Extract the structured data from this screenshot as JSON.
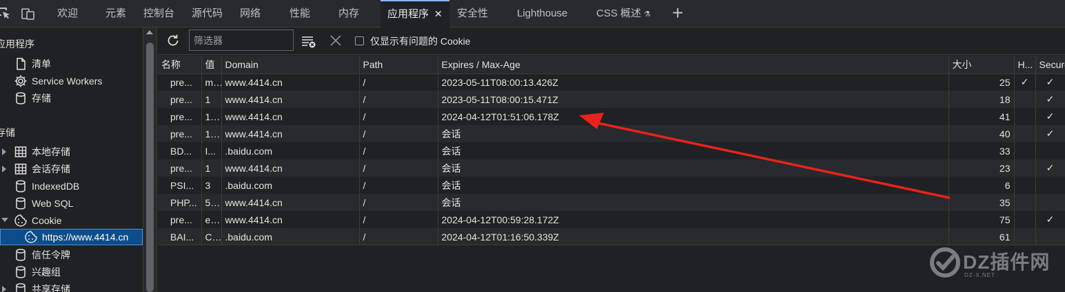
{
  "tabs": [
    {
      "label": "欢迎"
    },
    {
      "label": "元素"
    },
    {
      "label": "控制台"
    },
    {
      "label": "源代码"
    },
    {
      "label": "网络"
    },
    {
      "label": "性能"
    },
    {
      "label": "内存"
    },
    {
      "label": "应用程序",
      "active": true
    },
    {
      "label": "安全性"
    },
    {
      "label": "Lighthouse"
    },
    {
      "label": "CSS 概述"
    }
  ],
  "active_tab_close": "✕",
  "new_tab": "+",
  "sidebar": {
    "section_app": "应用程序",
    "app_items": [
      "清单",
      "Service Workers",
      "存储"
    ],
    "section_storage": "存储",
    "storage_items": [
      "本地存储",
      "会话存储",
      "IndexedDB",
      "Web SQL",
      "Cookie",
      "https://www.4414.cn",
      "信任令牌",
      "兴趣组",
      "共享存储"
    ]
  },
  "toolbar": {
    "filter_placeholder": "筛选器",
    "checkbox_label": "仅显示有问题的 Cookie"
  },
  "table": {
    "headers": [
      "名称",
      "值",
      "Domain",
      "Path",
      "Expires / Max-Age",
      "大小",
      "H...",
      "Secure"
    ],
    "rows": [
      [
        "pre...",
        "m...",
        "www.4414.cn",
        "/",
        "2023-05-11T08:00:13.426Z",
        "25",
        "✓",
        "✓"
      ],
      [
        "pre...",
        "1",
        "www.4414.cn",
        "/",
        "2023-05-11T08:00:15.471Z",
        "18",
        "",
        "✓"
      ],
      [
        "pre...",
        "1...",
        "www.4414.cn",
        "/",
        "2024-04-12T01:51:06.178Z",
        "41",
        "",
        "✓"
      ],
      [
        "pre...",
        "1...",
        "www.4414.cn",
        "/",
        "会话",
        "40",
        "",
        "✓"
      ],
      [
        "BD...",
        "I...",
        ".baidu.com",
        "/",
        "会话",
        "33",
        "",
        ""
      ],
      [
        "pre...",
        "1",
        "www.4414.cn",
        "/",
        "会话",
        "23",
        "",
        "✓"
      ],
      [
        "PSI...",
        "3",
        ".baidu.com",
        "/",
        "会话",
        "6",
        "",
        ""
      ],
      [
        "PHP...",
        "5...",
        "www.4414.cn",
        "/",
        "会话",
        "35",
        "",
        ""
      ],
      [
        "pre...",
        "e...",
        "www.4414.cn",
        "/",
        "2024-04-12T00:59:28.172Z",
        "75",
        "",
        "✓"
      ],
      [
        "BAI...",
        "C...",
        ".baidu.com",
        "/",
        "2024-04-12T01:16:50.339Z",
        "61",
        "",
        ""
      ]
    ]
  },
  "watermark": {
    "text": "DZ插件网",
    "sub": "DZ-X.NET"
  },
  "colors": {
    "accent": "#8ab4f8",
    "selected": "#0e4c8a",
    "annotation_arrow": "#e8231c"
  }
}
